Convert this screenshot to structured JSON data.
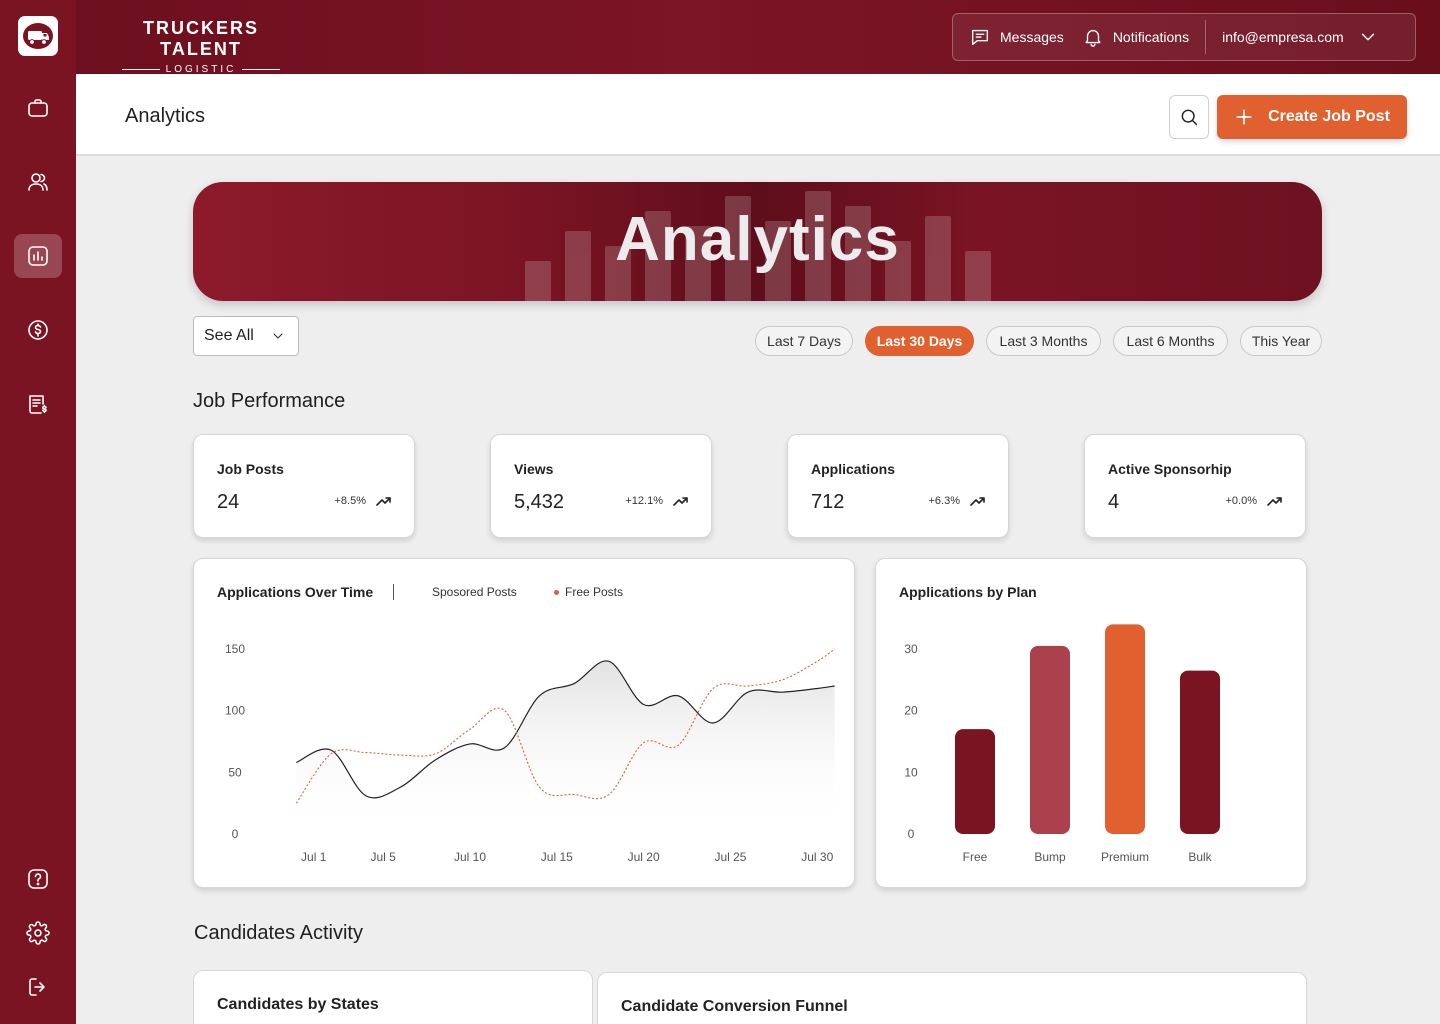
{
  "brand": {
    "name": "TRUCKERS TALENT",
    "sub": "LOGISTIC"
  },
  "top_actions": {
    "messages": "Messages",
    "notifications": "Notifications",
    "account": "info@empresa.com"
  },
  "header": {
    "title": "Analytics",
    "create_label": "Create Job Post"
  },
  "banner": {
    "title": "Analytics"
  },
  "filter": {
    "dropdown_value": "See All"
  },
  "ranges": [
    "Last 7 Days",
    "Last 30 Days",
    "Last 3 Months",
    "Last 6 Months",
    "This Year"
  ],
  "active_range": "Last 30 Days",
  "job_performance": {
    "title": "Job Performance",
    "cards": [
      {
        "label": "Job Posts",
        "value": "24",
        "change": "+8.5%"
      },
      {
        "label": "Views",
        "value": "5,432",
        "change": "+12.1%"
      },
      {
        "label": "Applications",
        "value": "712",
        "change": "+6.3%"
      },
      {
        "label": "Active Sponsorhip",
        "value": "4",
        "change": "+0.0%"
      }
    ]
  },
  "colors": {
    "primary": "#7a1322",
    "accent": "#e0612f",
    "bump": "#aa414d"
  },
  "chart_data": [
    {
      "type": "line",
      "title": "Applications Over Time",
      "x_ticks": [
        "Jul 1",
        "Jul 5",
        "Jul 10",
        "Jul 15",
        "Jul 20",
        "Jul 25",
        "Jul 30"
      ],
      "y_ticks": [
        0,
        50,
        100,
        150
      ],
      "ylim": [
        0,
        150
      ],
      "xlim": [
        -1,
        32
      ],
      "series": [
        {
          "name": "Sposored Posts",
          "color": "#222222",
          "style": "solid",
          "x": [
            0,
            2,
            4,
            6,
            8,
            10,
            12,
            14,
            16,
            18,
            20,
            22,
            24,
            26,
            28,
            30,
            31
          ],
          "y": [
            58,
            68,
            31,
            38,
            60,
            73,
            70,
            112,
            122,
            140,
            105,
            112,
            90,
            115,
            115,
            118,
            120
          ]
        },
        {
          "name": "Free Posts",
          "color": "#d9603a",
          "style": "dotted",
          "x": [
            0,
            2,
            4,
            6,
            8,
            10,
            12,
            14,
            16,
            18,
            20,
            22,
            24,
            26,
            28,
            30,
            31
          ],
          "y": [
            25,
            65,
            66,
            64,
            65,
            85,
            100,
            38,
            32,
            32,
            74,
            72,
            118,
            120,
            125,
            140,
            150
          ]
        }
      ],
      "grid": false
    },
    {
      "type": "bar",
      "title": "Applications by Plan",
      "categories": [
        "Free",
        "Bump",
        "Premium",
        "Bulk"
      ],
      "values": [
        17,
        30.5,
        34,
        26.5
      ],
      "colors": [
        "#7a1322",
        "#aa414d",
        "#e0612f",
        "#7a1322"
      ],
      "y_ticks": [
        0,
        10,
        20,
        30
      ],
      "ylim": [
        0,
        30
      ]
    }
  ],
  "candidates_activity": {
    "title": "Candidates Activity",
    "cards": [
      "Candidates by States",
      "Candidate Conversion Funnel"
    ]
  }
}
